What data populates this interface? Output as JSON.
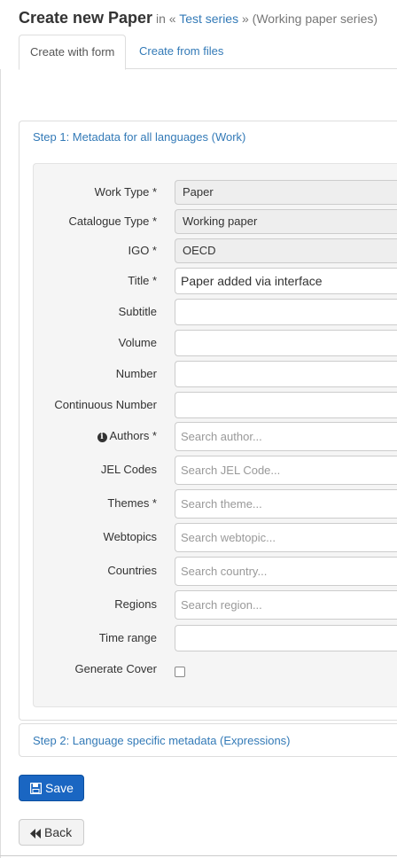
{
  "header": {
    "title": "Create new Paper",
    "in_text": "in «",
    "series_link": "Test series",
    "suffix": "» (Working paper series)"
  },
  "tabs": [
    {
      "label": "Create with form",
      "active": true
    },
    {
      "label": "Create from files",
      "active": false
    }
  ],
  "step1": {
    "heading": "Step 1: Metadata for all languages (Work)",
    "fields": {
      "work_type": {
        "label": "Work Type *",
        "value": "Paper"
      },
      "catalogue_type": {
        "label": "Catalogue Type *",
        "value": "Working paper"
      },
      "igo": {
        "label": "IGO *",
        "value": "OECD"
      },
      "title": {
        "label": "Title *",
        "value": "Paper added via interface"
      },
      "subtitle": {
        "label": "Subtitle",
        "value": ""
      },
      "volume": {
        "label": "Volume",
        "value": ""
      },
      "number": {
        "label": "Number",
        "value": ""
      },
      "continuous_number": {
        "label": "Continuous Number",
        "value": ""
      },
      "authors": {
        "label": "Authors *",
        "placeholder": "Search author..."
      },
      "jel_codes": {
        "label": "JEL Codes",
        "placeholder": "Search JEL Code..."
      },
      "themes": {
        "label": "Themes *",
        "placeholder": "Search theme..."
      },
      "webtopics": {
        "label": "Webtopics",
        "placeholder": "Search webtopic..."
      },
      "countries": {
        "label": "Countries",
        "placeholder": "Search country..."
      },
      "regions": {
        "label": "Regions",
        "placeholder": "Search region..."
      },
      "time_range": {
        "label": "Time range",
        "value": ""
      },
      "generate_cover": {
        "label": "Generate Cover",
        "checked": false
      }
    }
  },
  "step2": {
    "heading": "Step 2: Language specific metadata (Expressions)"
  },
  "buttons": {
    "save": "Save",
    "back": "Back"
  },
  "icons": {
    "info": "info-icon",
    "save": "floppy-disk-icon",
    "back": "backward-icon"
  },
  "colors": {
    "link": "#337ab7",
    "primary": "#1a66c2"
  }
}
